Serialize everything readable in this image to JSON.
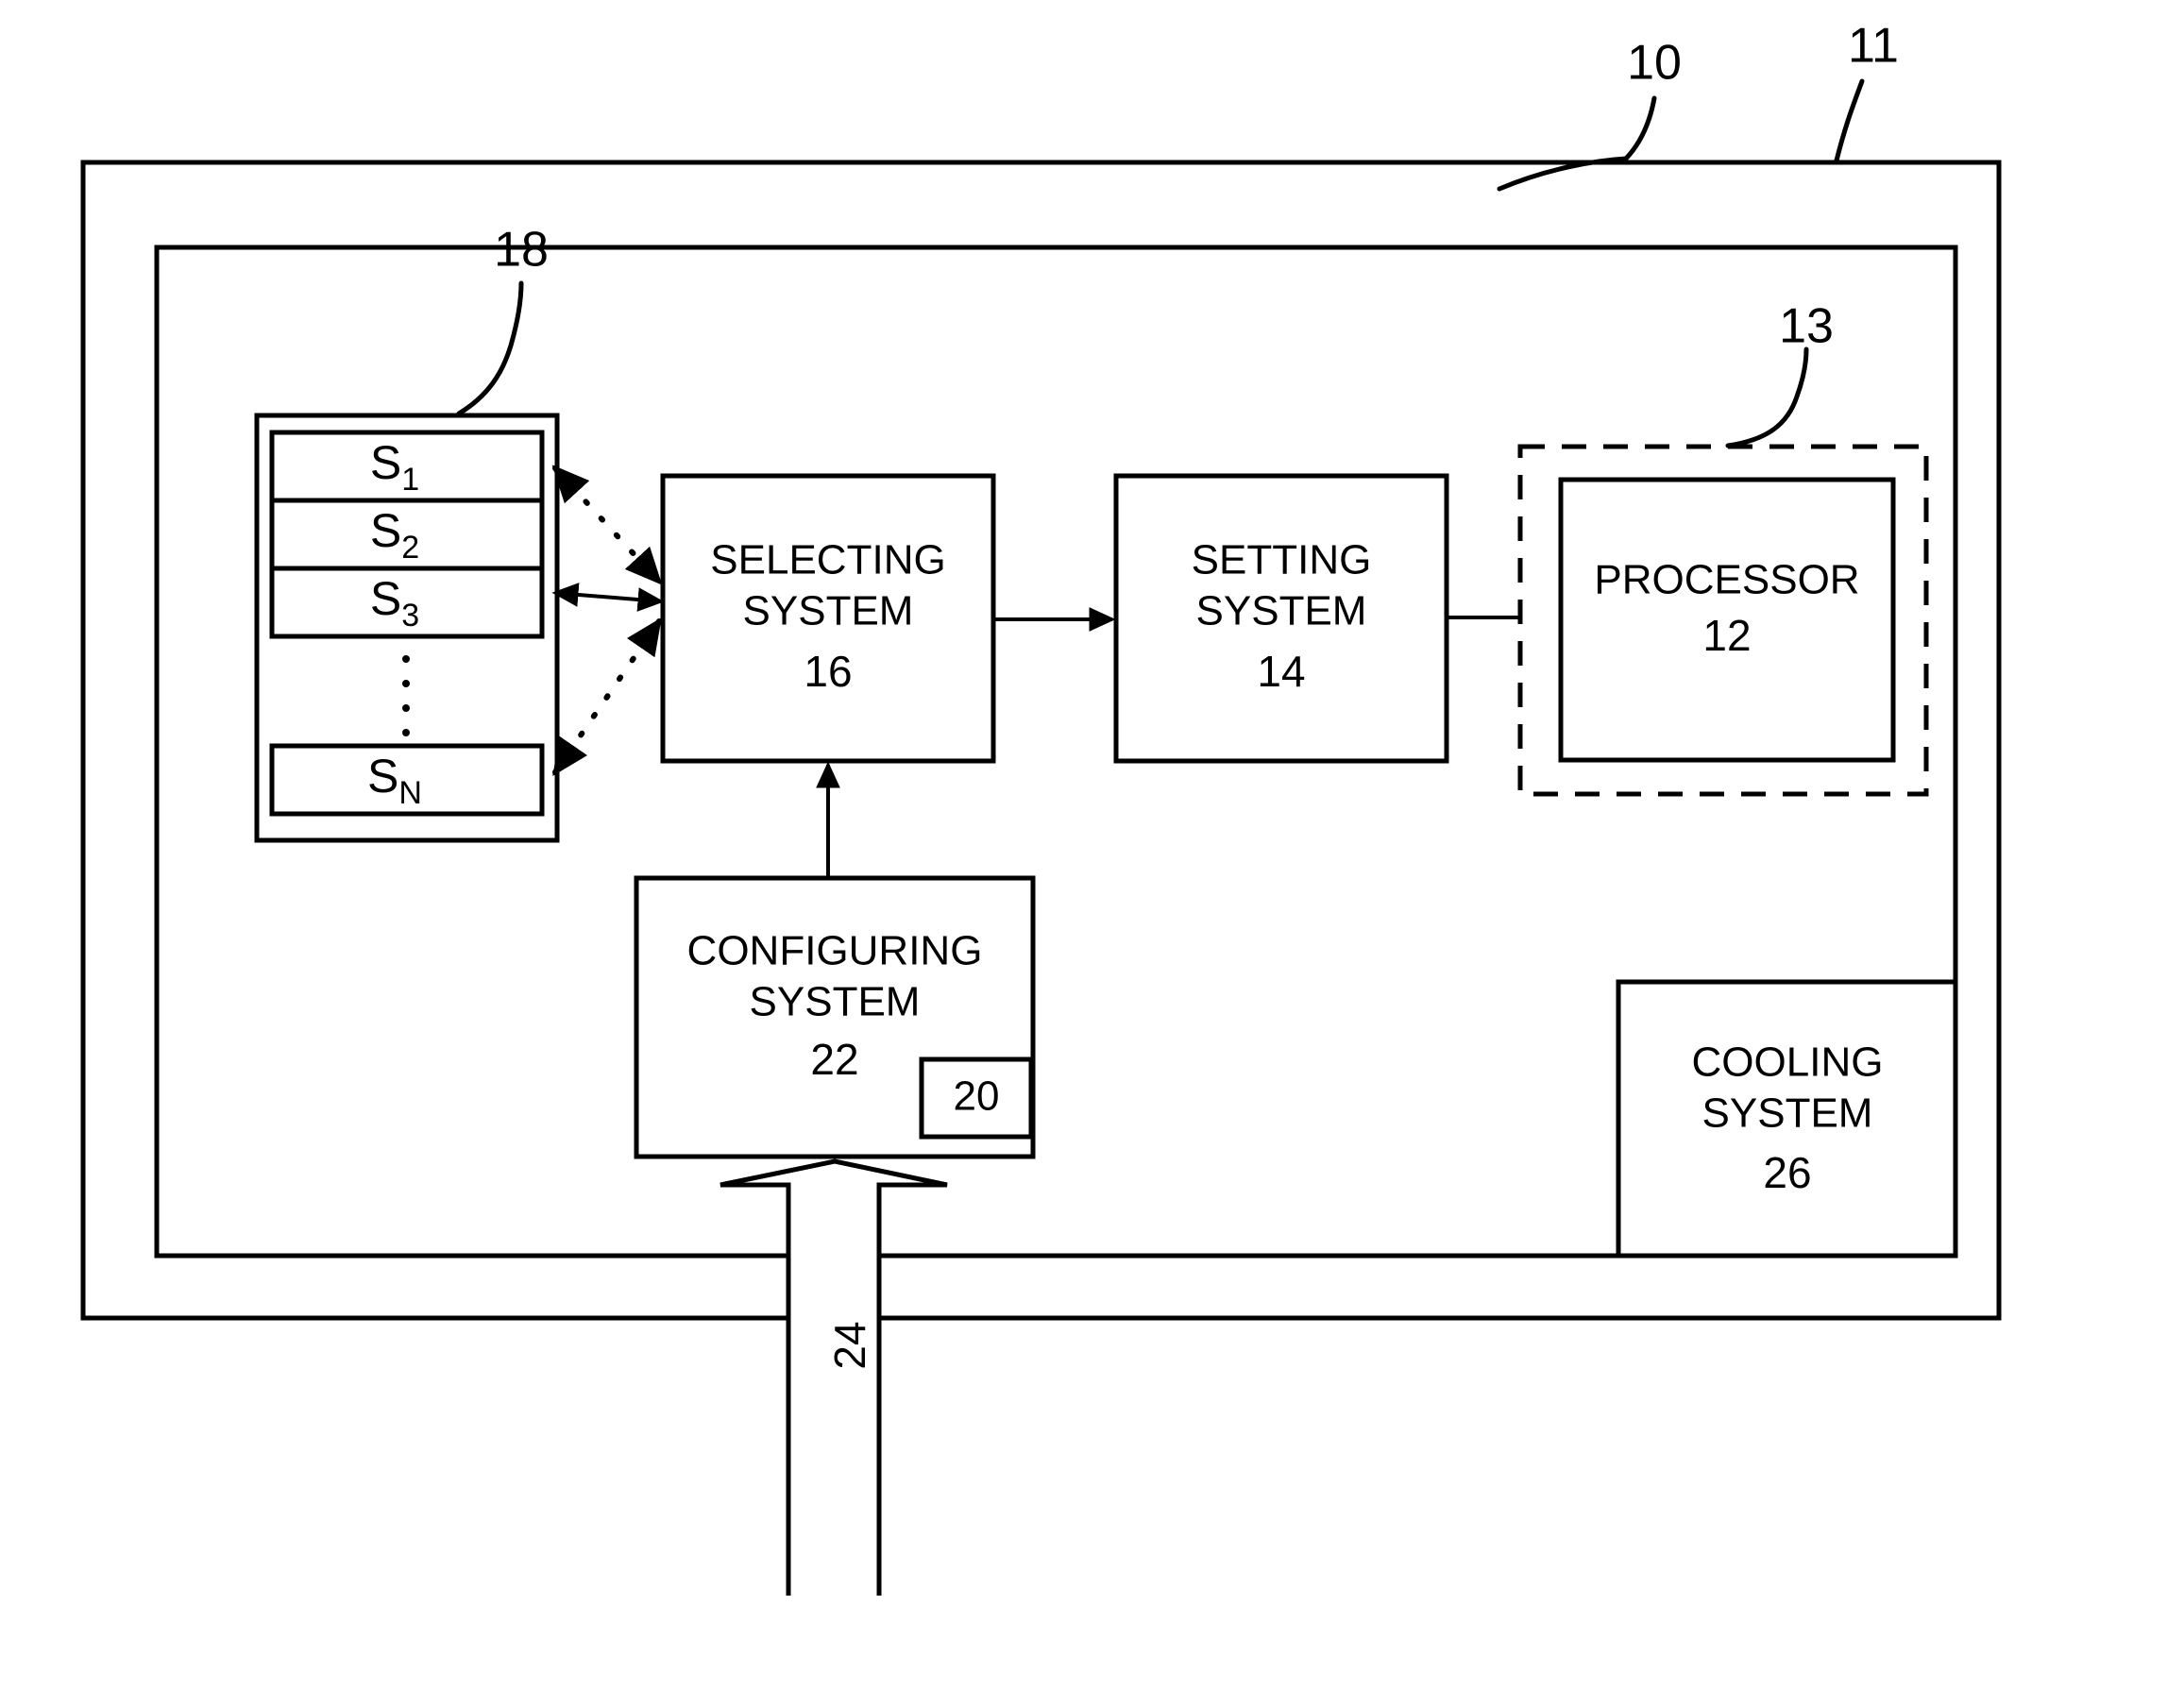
{
  "figure": {
    "outer_enclosure_ref": "11",
    "inner_enclosure_ref": "10",
    "stack_ref": "18",
    "dashed_group_ref": "13",
    "input_arrow_ref": "24"
  },
  "stack": {
    "items": [
      {
        "base": "S",
        "sub": "1"
      },
      {
        "base": "S",
        "sub": "2"
      },
      {
        "base": "S",
        "sub": "3"
      },
      {
        "base": "S",
        "sub": "N"
      }
    ],
    "ellipsis": "vertical-dots"
  },
  "blocks": {
    "selecting": {
      "line1": "SELECTING",
      "line2": "SYSTEM",
      "ref": "16"
    },
    "setting": {
      "line1": "SETTING",
      "line2": "SYSTEM",
      "ref": "14"
    },
    "processor": {
      "line1": "PROCESSOR",
      "ref": "12"
    },
    "configuring": {
      "line1": "CONFIGURING",
      "line2": "SYSTEM",
      "ref": "22",
      "inner_ref": "20"
    },
    "cooling": {
      "line1": "COOLING",
      "line2": "SYSTEM",
      "ref": "26"
    }
  },
  "colors": {
    "ink": "#000000",
    "paper": "#ffffff"
  }
}
